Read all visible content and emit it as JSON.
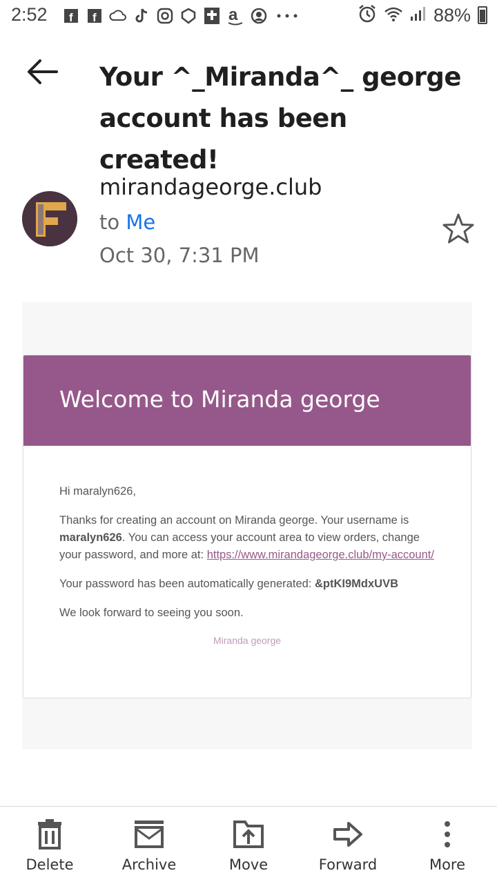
{
  "status_bar": {
    "time": "2:52",
    "battery_percent": "88%",
    "icons": [
      "facebook-icon",
      "facebook-icon",
      "cloud-icon",
      "tiktok-icon",
      "instagram-icon",
      "shield-icon",
      "bible-icon",
      "amazon-icon",
      "account-icon",
      "more-dots-icon",
      "alarm-icon",
      "wifi-icon",
      "signal-icon",
      "battery-icon"
    ]
  },
  "header": {
    "subject": "Your ^_Miranda^_ george account has been created!"
  },
  "sender": {
    "name": "mirandageorge.club",
    "to_prefix": "to",
    "to_name": "Me",
    "date": "Oct 30, 7:31 PM",
    "avatar_letter": "F"
  },
  "email": {
    "banner_title": "Welcome to Miranda george",
    "greeting": "Hi maralyn626,",
    "p1_start": "Thanks for creating an account on Miranda george. Your username is",
    "username": "maralyn626",
    "p1_mid": ". You can access your account area to view orders, change your password, and more at:",
    "account_link": "https://www.mirandageorge.club/my-account/",
    "p2_start": "Your password has been automatically generated:",
    "password": "&ptKI9MdxUVB",
    "closing": "We look forward to seeing you soon.",
    "footer": "Miranda george",
    "accent_color": "#96588a"
  },
  "toolbar": {
    "delete": "Delete",
    "archive": "Archive",
    "move": "Move",
    "forward": "Forward",
    "more": "More"
  }
}
